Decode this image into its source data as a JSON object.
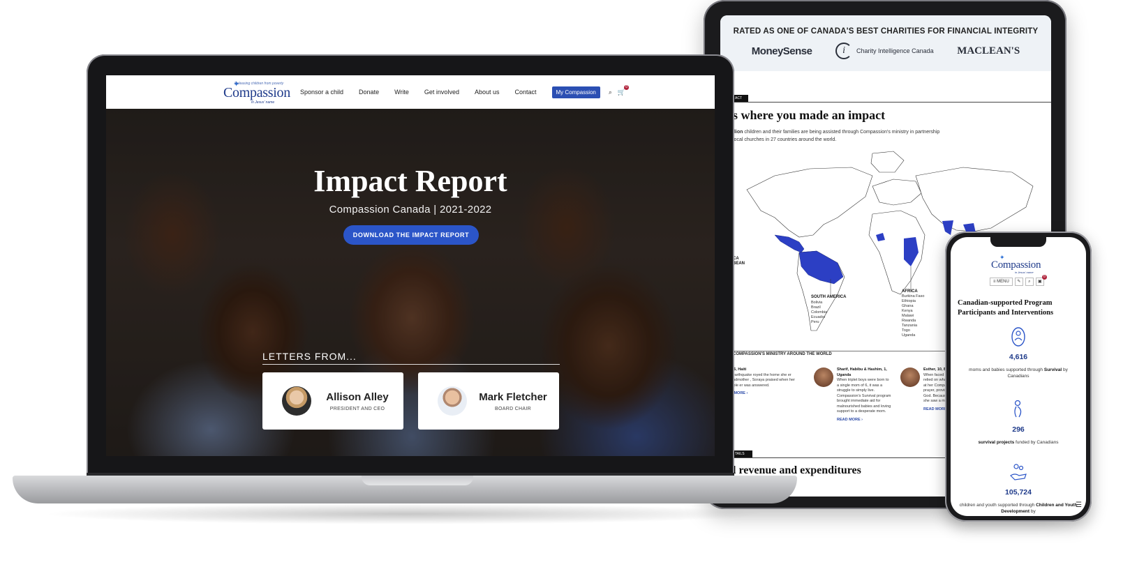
{
  "tablet": {
    "rated_title": "RATED AS ONE OF CANADA'S BEST CHARITIES FOR FINANCIAL INTEGRITY",
    "logos": [
      "MoneySense",
      "Charity Intelligence Canada",
      "MACLEAN'S"
    ],
    "section_tag": "ACT",
    "heading": "s where you made an impact",
    "intro_bold": "llion",
    "intro_text": " children and their families are being assisted through Compassion's ministry in partnership local churches in 27 countries around the world.",
    "map_regions": [
      {
        "name": "SOUTH AMERICA",
        "countries": [
          "Bolivia",
          "Brazil",
          "Colombia",
          "Ecuador",
          "Peru"
        ]
      },
      {
        "name": "AFRICA",
        "countries": [
          "Burkina Faso",
          "Ethiopia",
          "Ghana",
          "Kenya",
          "Malawi",
          "Rwanda",
          "Tanzania",
          "Togo",
          "Uganda"
        ]
      },
      {
        "name": "CA",
        "countries": [
          "BEAN"
        ]
      }
    ],
    "ministry_title": "COMPASSION'S MINISTRY AROUND THE WORLD",
    "stories": [
      {
        "name": "ya, 6, Haiti",
        "text": "an earthquake royed the home she er grandmother , Soraya praised when her simple er was answered.",
        "more": "AD MORE ›"
      },
      {
        "name": "Sharif, Habibu & Hashim, 1, Uganda",
        "text": "When triplet boys were born to a single mom of 6, it was a struggle to simply live. Compassion's Survival program brought immediate aid for malnourished babies and loving support to a desperate mom.",
        "more": "READ MORE ›"
      },
      {
        "name": "Esther, 10, Burkina Faso",
        "text": "When faced with crisis, Esther relied on what she had learned at her Compassion centre about prayer, provision and trusting in God. Because of sponsorship, she saw a miracle.",
        "more": "READ MORE ›"
      }
    ],
    "details_tag": "TAILS",
    "heading2": "l revenue and expenditures"
  },
  "laptop": {
    "brand": {
      "tagline": "Releasing children from poverty",
      "name": "Compassion",
      "sub": "in Jesus' name"
    },
    "nav": [
      "Sponsor a child",
      "Donate",
      "Write",
      "Get involved",
      "About us",
      "Contact"
    ],
    "nav_button": "My Compassion",
    "cart_count": "0",
    "hero_title": "Impact Report",
    "hero_subtitle": "Compassion Canada | 2021-2022",
    "hero_button": "DOWNLOAD THE IMPACT REPORT",
    "letters_heading": "LETTERS FROM...",
    "letters": [
      {
        "name": "Allison Alley",
        "role": "PRESIDENT AND CEO"
      },
      {
        "name": "Mark Fletcher",
        "role": "BOARD CHAIR"
      }
    ]
  },
  "phone": {
    "menu_label": "≡ MENU",
    "cart_count": "0",
    "heading": "Canadian-supported Program Participants and Interventions",
    "stats": [
      {
        "value": "4,616",
        "desc_pre": "moms and babies supported through ",
        "desc_bold": "Survival",
        "desc_post": " by Canadians"
      },
      {
        "value": "296",
        "desc_pre": "",
        "desc_bold": "survival projects",
        "desc_post": " funded by Canadians"
      },
      {
        "value": "105,724",
        "desc_pre": "children and youth supported through ",
        "desc_bold": "Children and Youth Development",
        "desc_post": " by"
      }
    ]
  },
  "colors": {
    "brand_blue": "#2b4fb3",
    "map_blue": "#2c3fc4",
    "badge_red": "#b0233b"
  }
}
